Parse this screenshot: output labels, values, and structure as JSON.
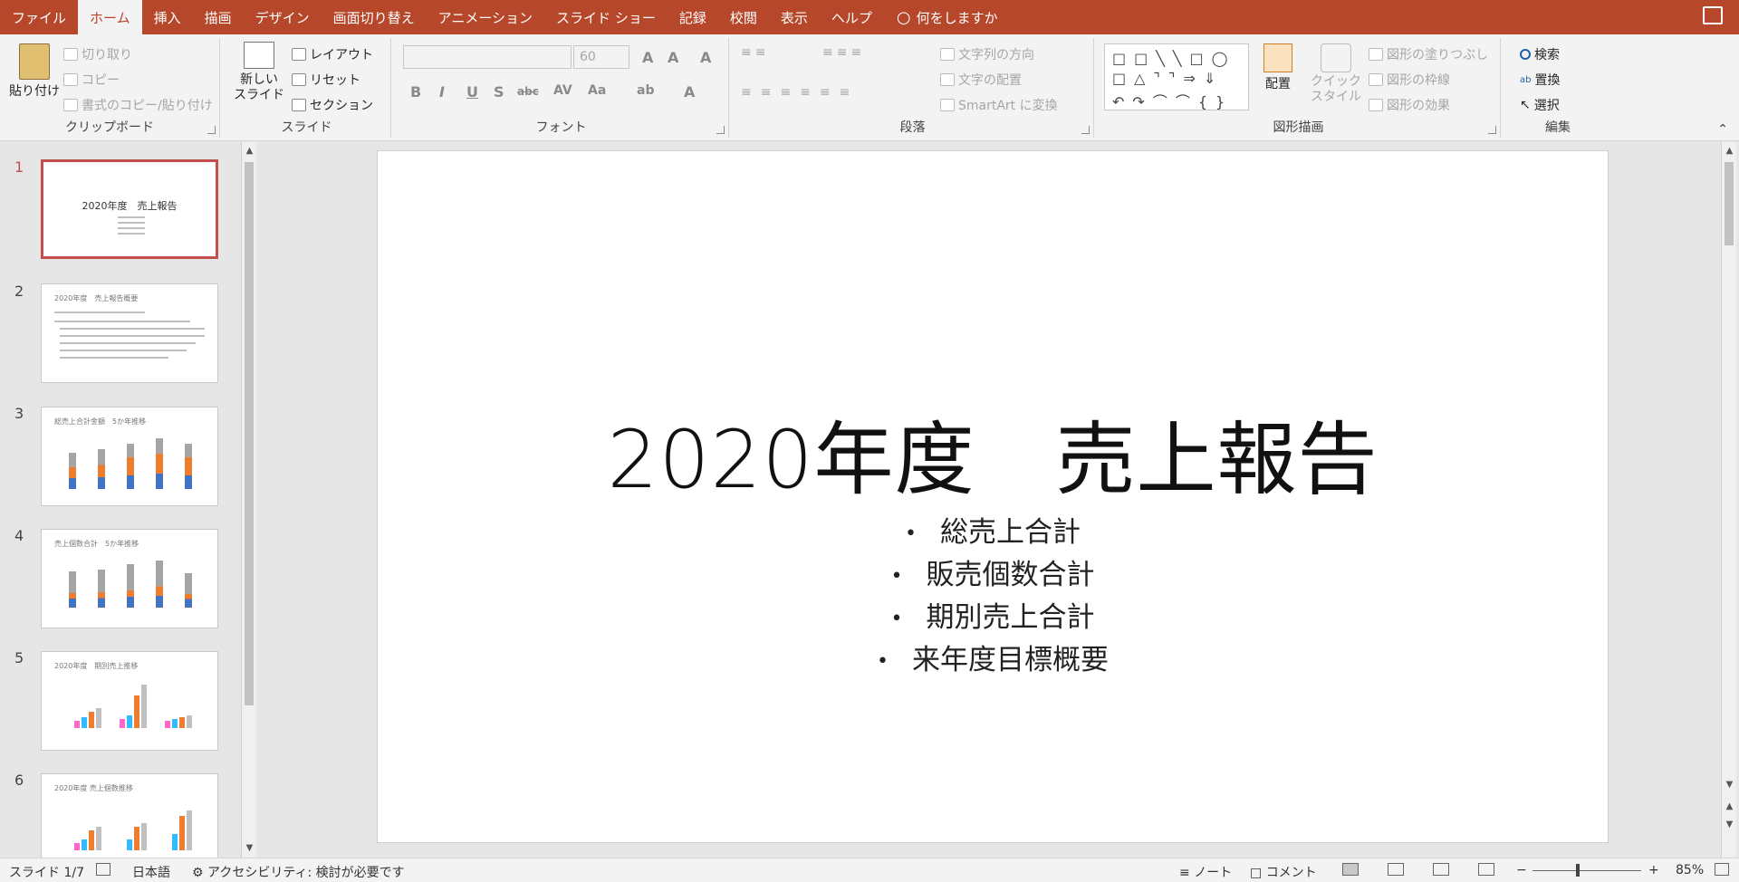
{
  "tabs": [
    "ファイル",
    "ホーム",
    "挿入",
    "描画",
    "デザイン",
    "画面切り替え",
    "アニメーション",
    "スライド ショー",
    "記録",
    "校閲",
    "表示",
    "ヘルプ"
  ],
  "active_tab": "ホーム",
  "tell_me": "何をしますか",
  "clipboard": {
    "paste": "貼り付け",
    "cut": "切り取り",
    "copy": "コピー",
    "format_painter": "書式のコピー/貼り付け",
    "label": "クリップボード"
  },
  "slides_group": {
    "new_slide_1": "新しい",
    "new_slide_2": "スライド",
    "layout": "レイアウト",
    "reset": "リセット",
    "section": "セクション",
    "label": "スライド"
  },
  "font": {
    "size": "60",
    "label": "フォント"
  },
  "paragraph": {
    "text_direction": "文字列の方向",
    "align_text": "文字の配置",
    "smartart": "SmartArt に変換",
    "label": "段落"
  },
  "drawing": {
    "arrange": "配置",
    "quick_styles_1": "クイック",
    "quick_styles_2": "スタイル",
    "shape_fill": "図形の塗りつぶし",
    "shape_outline": "図形の枠線",
    "shape_effects": "図形の効果",
    "label": "図形描画"
  },
  "editing": {
    "find": "検索",
    "replace": "置換",
    "select": "選択",
    "label": "編集"
  },
  "thumbnails": [
    {
      "num": "1",
      "title": "2020年度　売上報告"
    },
    {
      "num": "2",
      "title": "2020年度　売上報告概要"
    },
    {
      "num": "3",
      "title": "総売上合計金額　5か年推移"
    },
    {
      "num": "4",
      "title": "売上個数合計　5か年推移"
    },
    {
      "num": "5",
      "title": "2020年度　期別売上推移"
    },
    {
      "num": "6",
      "title": "2020年度 売上個数推移"
    }
  ],
  "slide": {
    "title": "2020年度　売上報告",
    "bullets": [
      "総売上合計",
      "販売個数合計",
      "期別売上合計",
      "来年度目標概要"
    ]
  },
  "status": {
    "slide_counter": "スライド 1/7",
    "language": "日本語",
    "accessibility": "アクセシビリティ: 検討が必要です",
    "notes": "ノート",
    "comments": "コメント",
    "zoom": "85%"
  },
  "colors": {
    "accent": "#b7472a",
    "selection": "#c0504d"
  }
}
